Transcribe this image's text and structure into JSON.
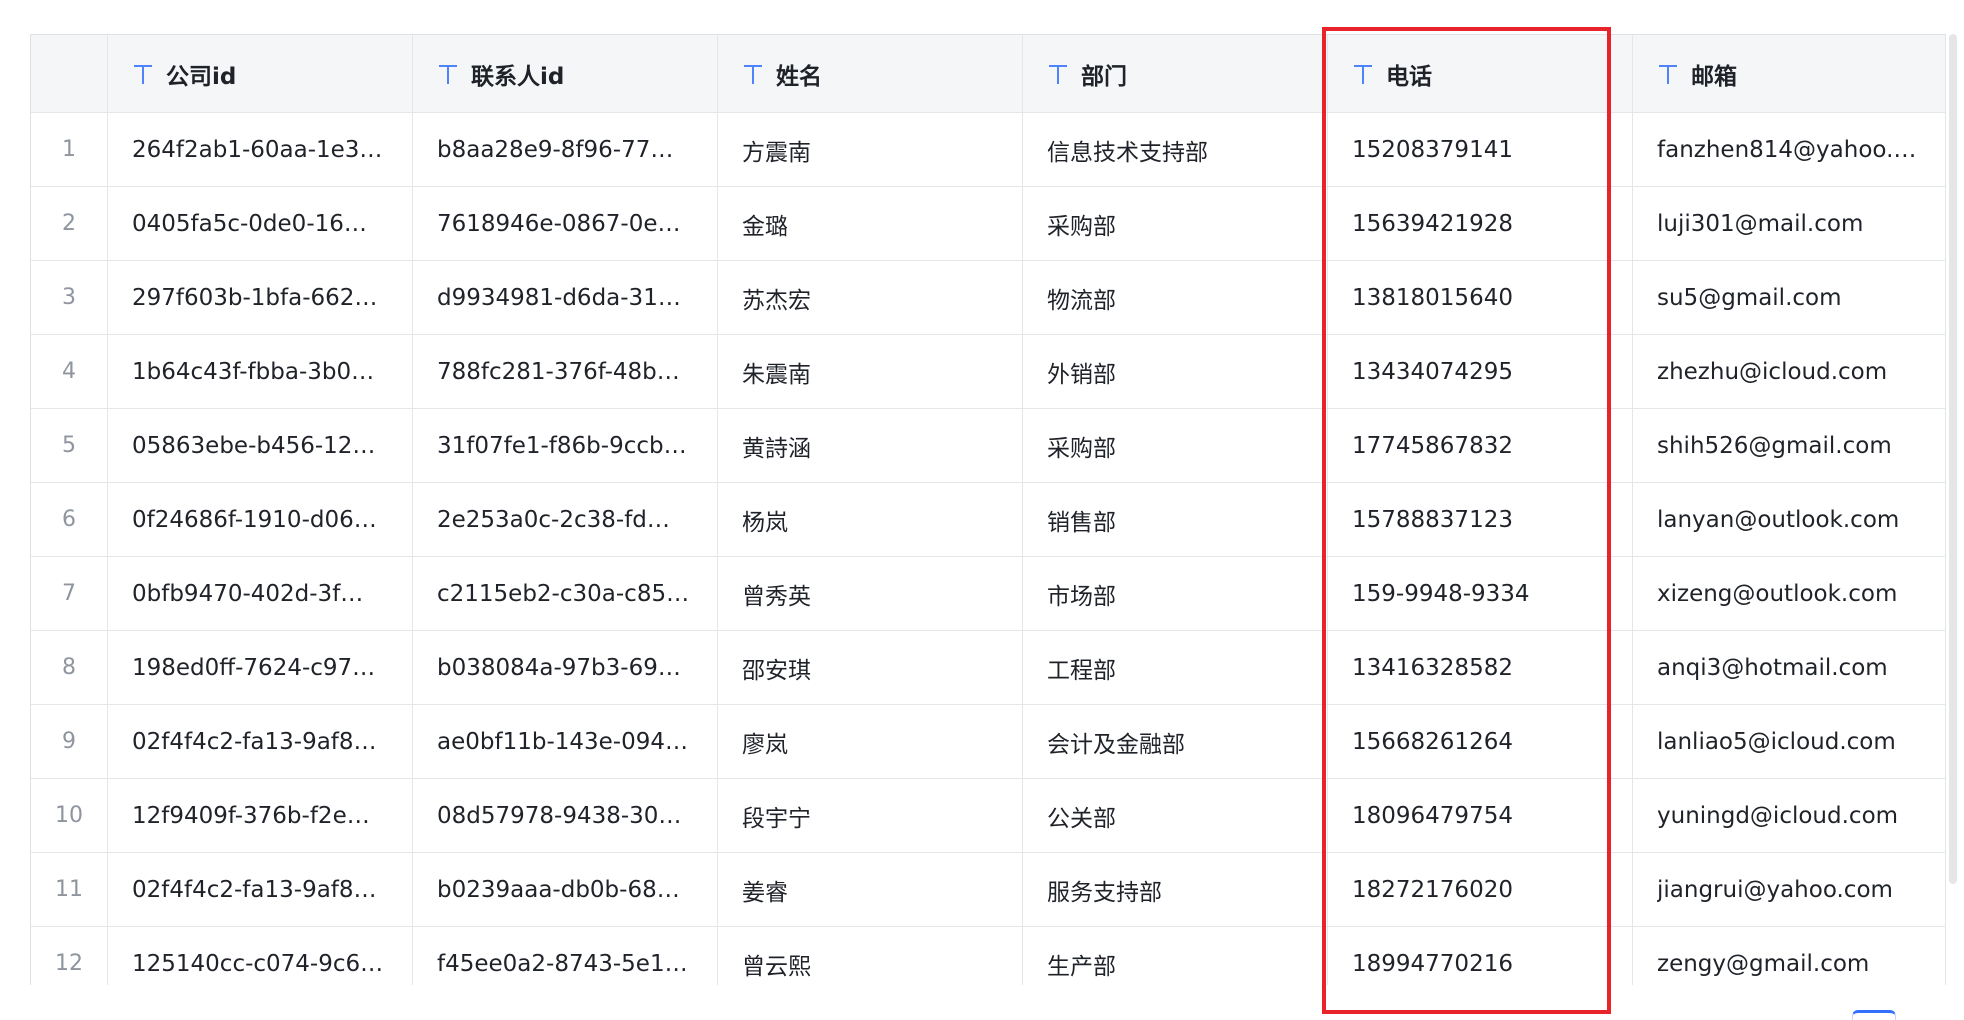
{
  "table": {
    "columns": [
      {
        "key": "company_id",
        "label": "公司id",
        "type_icon": "text-type-icon"
      },
      {
        "key": "contact_id",
        "label": "联系人id",
        "type_icon": "text-type-icon"
      },
      {
        "key": "name",
        "label": "姓名",
        "type_icon": "text-type-icon"
      },
      {
        "key": "department",
        "label": "部门",
        "type_icon": "text-type-icon"
      },
      {
        "key": "phone",
        "label": "电话",
        "type_icon": "text-type-icon"
      },
      {
        "key": "email",
        "label": "邮箱",
        "type_icon": "text-type-icon"
      }
    ],
    "rows": [
      {
        "index": "1",
        "company_id": "264f2ab1-60aa-1e3…",
        "contact_id": "b8aa28e9-8f96-77…",
        "name": "方震南",
        "department": "信息技术支持部",
        "phone": "15208379141",
        "email": "fanzhen814@yahoo.…"
      },
      {
        "index": "2",
        "company_id": "0405fa5c-0de0-16…",
        "contact_id": "7618946e-0867-0e…",
        "name": "金璐",
        "department": "采购部",
        "phone": "15639421928",
        "email": "luji301@mail.com"
      },
      {
        "index": "3",
        "company_id": "297f603b-1bfa-662…",
        "contact_id": "d9934981-d6da-31…",
        "name": "苏杰宏",
        "department": "物流部",
        "phone": "13818015640",
        "email": "su5@gmail.com"
      },
      {
        "index": "4",
        "company_id": "1b64c43f-fbba-3b0…",
        "contact_id": "788fc281-376f-48b…",
        "name": "朱震南",
        "department": "外销部",
        "phone": "13434074295",
        "email": "zhezhu@icloud.com"
      },
      {
        "index": "5",
        "company_id": "05863ebe-b456-12…",
        "contact_id": "31f07fe1-f86b-9ccb…",
        "name": "黄詩涵",
        "department": "采购部",
        "phone": "17745867832",
        "email": "shih526@gmail.com"
      },
      {
        "index": "6",
        "company_id": "0f24686f-1910-d06…",
        "contact_id": "2e253a0c-2c38-fd…",
        "name": "杨岚",
        "department": "销售部",
        "phone": "15788837123",
        "email": "lanyan@outlook.com"
      },
      {
        "index": "7",
        "company_id": "0bfb9470-402d-3f…",
        "contact_id": "c2115eb2-c30a-c85…",
        "name": "曾秀英",
        "department": "市场部",
        "phone": "159-9948-9334",
        "email": "xizeng@outlook.com"
      },
      {
        "index": "8",
        "company_id": "198ed0ff-7624-c97…",
        "contact_id": "b038084a-97b3-69…",
        "name": "邵安琪",
        "department": "工程部",
        "phone": "13416328582",
        "email": "anqi3@hotmail.com"
      },
      {
        "index": "9",
        "company_id": "02f4f4c2-fa13-9af8…",
        "contact_id": "ae0bf11b-143e-094…",
        "name": "廖岚",
        "department": "会计及金融部",
        "phone": "15668261264",
        "email": "lanliao5@icloud.com"
      },
      {
        "index": "10",
        "company_id": "12f9409f-376b-f2e…",
        "contact_id": "08d57978-9438-30…",
        "name": "段宇宁",
        "department": "公关部",
        "phone": "18096479754",
        "email": "yuningd@icloud.com"
      },
      {
        "index": "11",
        "company_id": "02f4f4c2-fa13-9af8…",
        "contact_id": "b0239aaa-db0b-68…",
        "name": "姜睿",
        "department": "服务支持部",
        "phone": "18272176020",
        "email": "jiangrui@yahoo.com"
      },
      {
        "index": "12",
        "company_id": "125140cc-c074-9c6…",
        "contact_id": "f45ee0a2-8743-5e1…",
        "name": "曾云熙",
        "department": "生产部",
        "phone": "18994770216",
        "email": "zengy@gmail.com"
      }
    ]
  },
  "colors": {
    "accent": "#4e83fd",
    "highlight_border": "#e8232a",
    "header_bg": "#f5f6f7",
    "grid_line": "#e4e6ea",
    "index_text": "#8f959e"
  }
}
